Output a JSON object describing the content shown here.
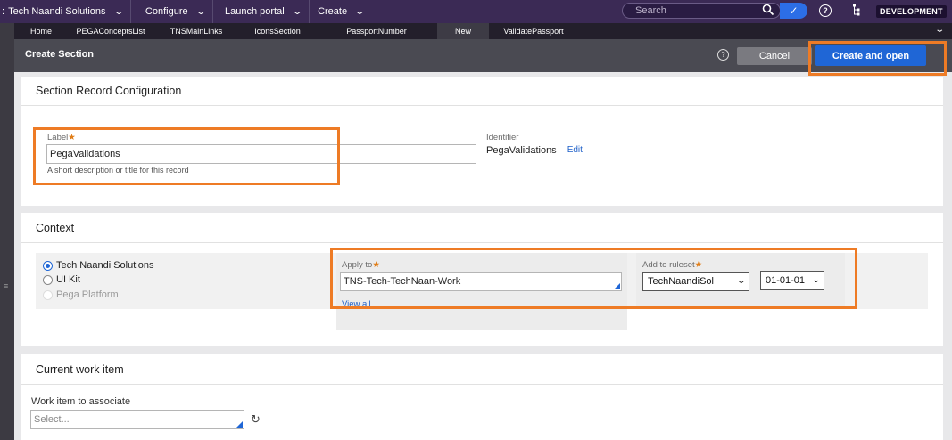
{
  "topbar": {
    "app_menu": "Tech Naandi Solutions",
    "app_prefix": ":",
    "menus": [
      "Configure",
      "Launch portal",
      "Create"
    ],
    "search_placeholder": "Search",
    "environment": "DEVELOPMENT"
  },
  "tabs": [
    {
      "label": "Home",
      "active": false
    },
    {
      "label": "PEGAConceptsList",
      "active": false
    },
    {
      "label": "TNSMainLinks",
      "active": false
    },
    {
      "label": "IconsSection",
      "active": false
    },
    {
      "label": "PassportNumber",
      "active": false
    },
    {
      "label": "New",
      "active": true
    },
    {
      "label": "ValidatePassport",
      "active": false
    }
  ],
  "header": {
    "title": "Create Section",
    "cancel_label": "Cancel",
    "create_label": "Create and open"
  },
  "record_config": {
    "title": "Section Record Configuration",
    "label_field": "Label",
    "label_value": "PegaValidations",
    "label_hint": "A short description or title for this record",
    "identifier_label": "Identifier",
    "identifier_value": "PegaValidations",
    "edit_link": "Edit"
  },
  "context": {
    "title": "Context",
    "radios": [
      {
        "label": "Tech Naandi Solutions",
        "state": "selected"
      },
      {
        "label": "UI Kit",
        "state": "unselected"
      },
      {
        "label": "Pega Platform",
        "state": "disabled"
      }
    ],
    "apply_to_label": "Apply to",
    "apply_to_value": "TNS-Tech-TechNaan-Work",
    "view_all": "View all",
    "ruleset_label": "Add to ruleset",
    "ruleset_value": "TechNaandiSol",
    "version_value": "01-01-01"
  },
  "work_item": {
    "title": "Current work item",
    "field_label": "Work item to associate",
    "placeholder": "Select..."
  },
  "colors": {
    "topbar": "#3b2a55",
    "primary_button": "#1f66d6",
    "highlight": "#ee7b25",
    "required": "#e07d17"
  }
}
